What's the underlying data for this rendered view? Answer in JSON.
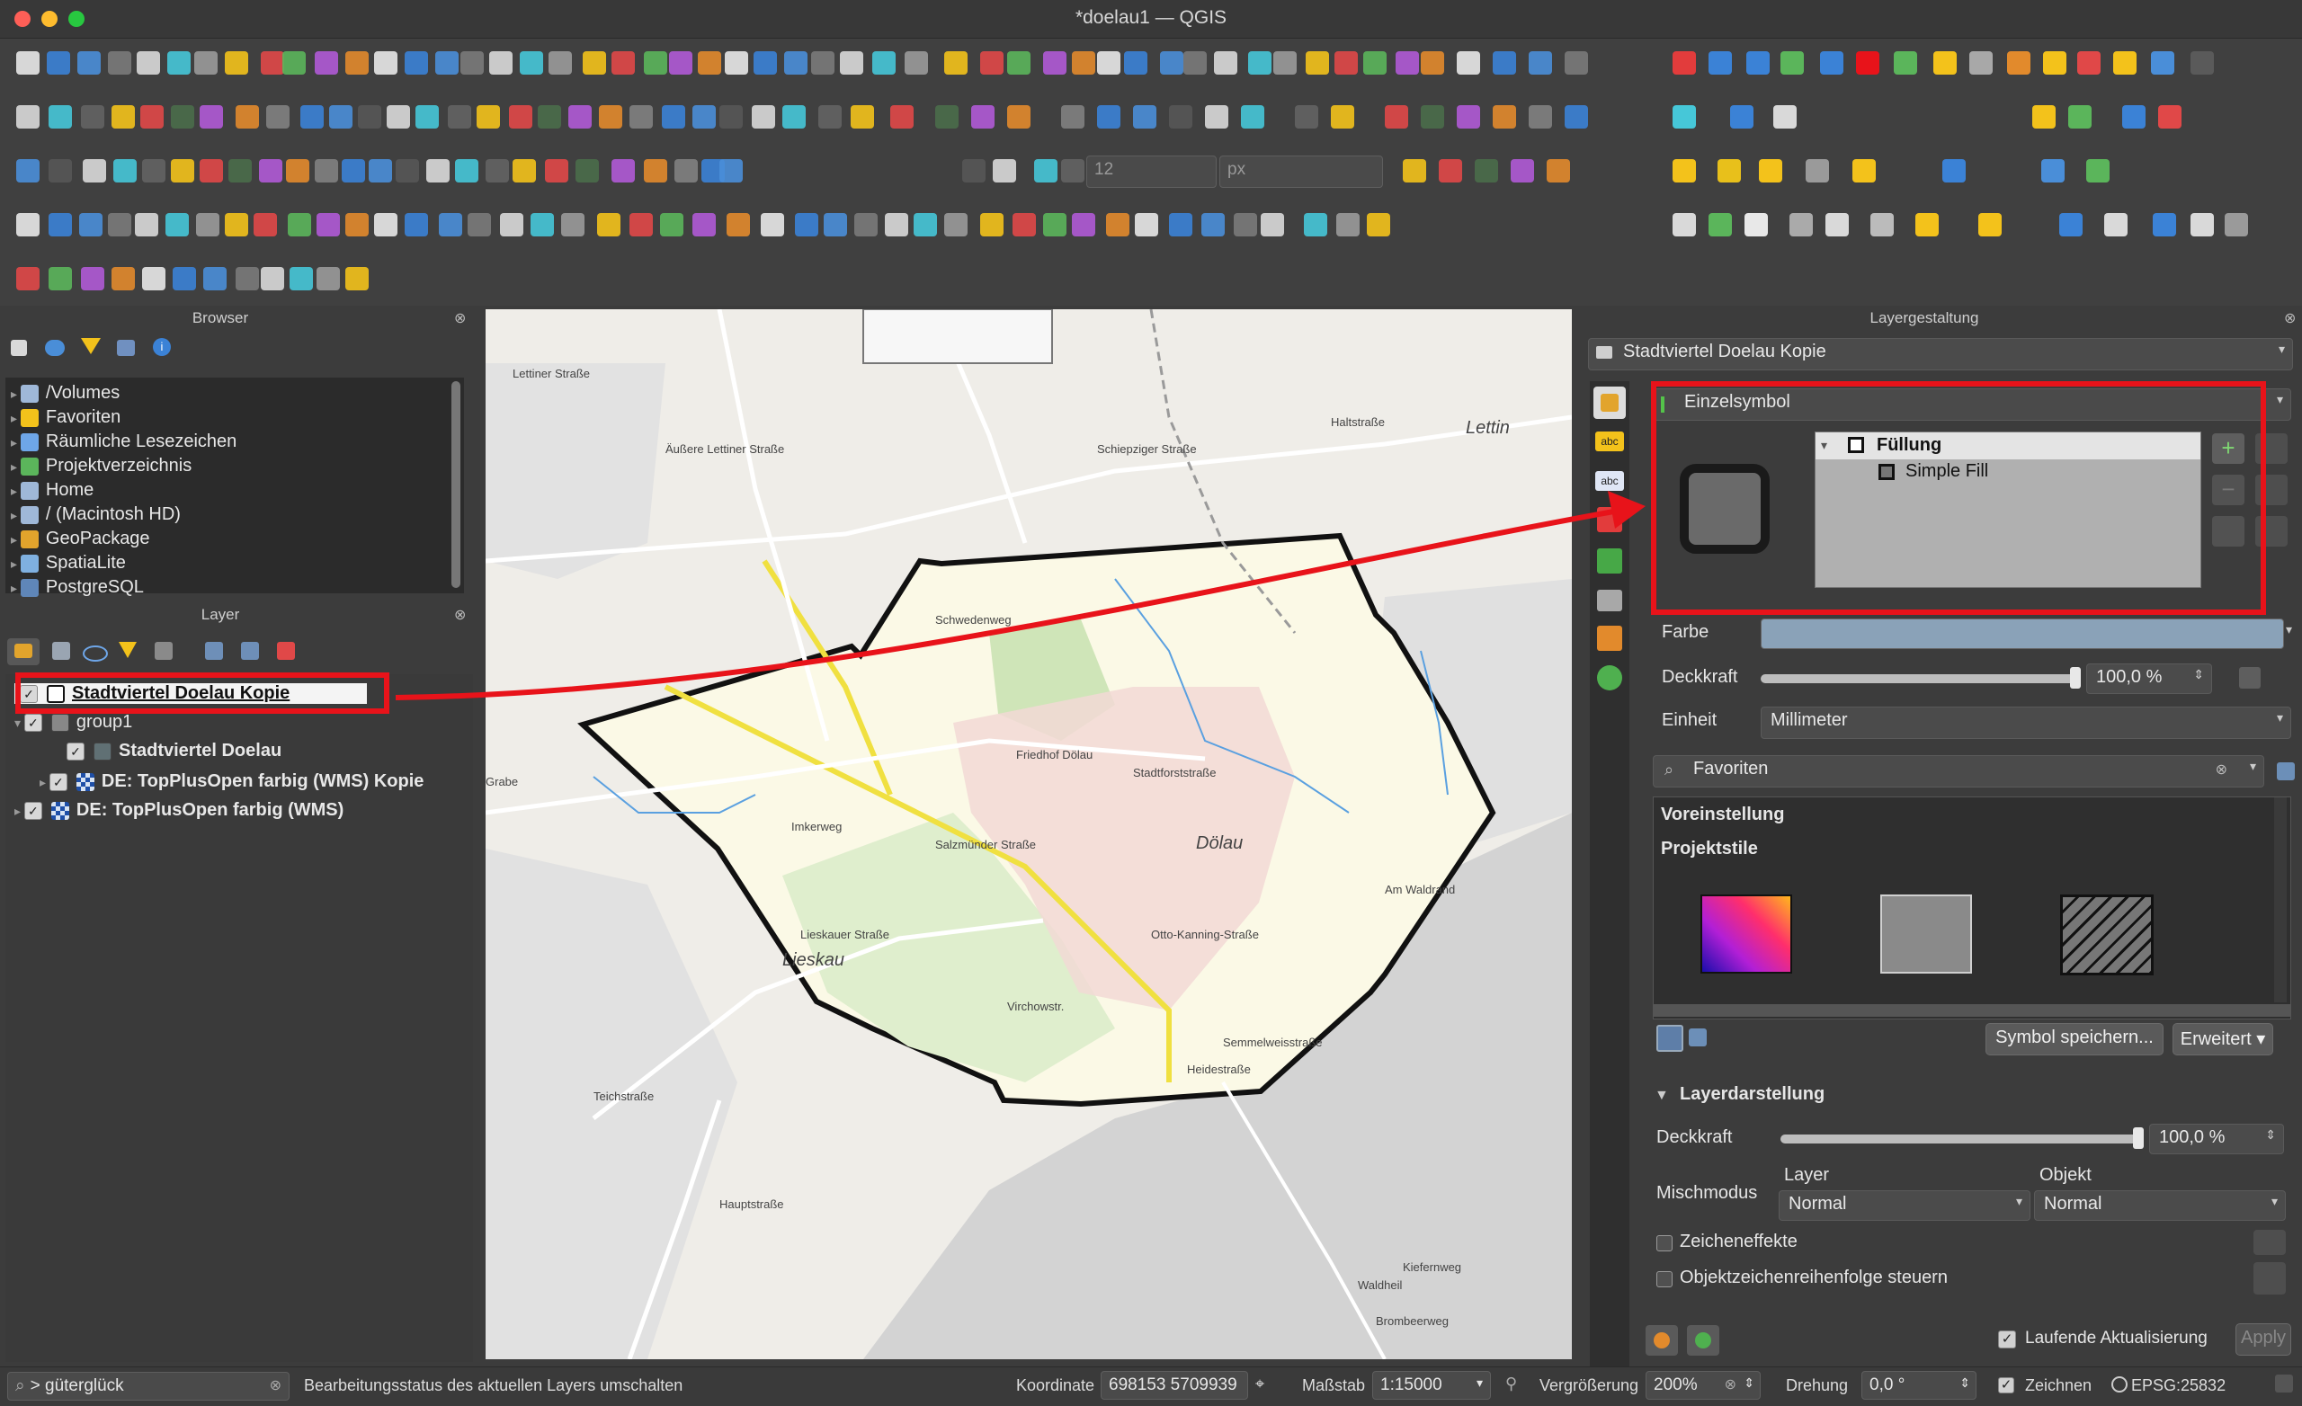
{
  "window": {
    "title": "*doelau1 — QGIS"
  },
  "toolbar": {
    "scale_value": "12",
    "unit_value": "px"
  },
  "browser": {
    "title": "Browser",
    "items": [
      {
        "label": "/Volumes",
        "icon": "folder-icon"
      },
      {
        "label": "Favoriten",
        "icon": "star-icon"
      },
      {
        "label": "Räumliche Lesezeichen",
        "icon": "bookmark-icon"
      },
      {
        "label": "Projektverzeichnis",
        "icon": "project-folder-icon"
      },
      {
        "label": "Home",
        "icon": "folder-icon"
      },
      {
        "label": "/ (Macintosh HD)",
        "icon": "folder-icon"
      },
      {
        "label": "GeoPackage",
        "icon": "geopackage-icon"
      },
      {
        "label": "SpatiaLite",
        "icon": "spatialite-icon"
      },
      {
        "label": "PostgreSQL",
        "icon": "postgresql-icon"
      }
    ]
  },
  "layers": {
    "title": "Layer",
    "items": [
      {
        "label": "Stadtviertel Doelau Kopie",
        "checked": true
      },
      {
        "label": "group1",
        "checked": true
      },
      {
        "label": "Stadtviertel Doelau",
        "checked": true
      },
      {
        "label": "DE: TopPlusOpen farbig (WMS) Kopie",
        "checked": true
      },
      {
        "label": "DE: TopPlusOpen farbig (WMS)",
        "checked": true
      }
    ]
  },
  "map": {
    "labels": [
      "Lettin",
      "Dölau",
      "Lieskau",
      "Schwedenweg",
      "Lettiner Straße",
      "Äußere Lettiner Straße",
      "Schiepziger Straße",
      "Salzmünder Straße",
      "Friedhof Dölau",
      "Stadtforststraße",
      "Grabe",
      "Haltstraße",
      "Imkerweg",
      "Lieskauer Straße",
      "Semmelweisstraße",
      "Heidestraße",
      "Kiefernweg",
      "Waldheil",
      "Brombeerweg",
      "Virchowstr.",
      "Otto-Kanning-Straße",
      "Am Waldrand",
      "Teichstraße",
      "Hauptstraße"
    ]
  },
  "style_panel": {
    "title": "Layergestaltung",
    "layer_combo": "Stadtviertel Doelau Kopie",
    "renderer": "Einzelsymbol",
    "symbol_tree": {
      "root": "Füllung",
      "child": "Simple Fill"
    },
    "farbe_label": "Farbe",
    "deckkraft_label": "Deckkraft",
    "deckkraft_value": "100,0 %",
    "einheit_label": "Einheit",
    "einheit_value": "Millimeter",
    "search_placeholder": "Favoriten",
    "styles": {
      "heading1": "Voreinstellung",
      "heading2": "Projektstile"
    },
    "save_button": "Symbol speichern...",
    "advanced_button": "Erweitert",
    "layer_render": {
      "heading": "Layerdarstellung",
      "deckkraft_label": "Deckkraft",
      "deckkraft_value": "100,0 %",
      "mischmodus_label": "Mischmodus",
      "layer_col": "Layer",
      "objekt_col": "Objekt",
      "layer_mode": "Normal",
      "objekt_mode": "Normal",
      "effekte_label": "Zeicheneffekte",
      "reihenfolge_label": "Objektzeichenreihenfolge steuern"
    },
    "live_update_label": "Laufende Aktualisierung",
    "apply_button": "Apply"
  },
  "status": {
    "search_value": "> güterglück",
    "message": "Bearbeitungsstatus des aktuellen Layers umschalten",
    "koordinate_label": "Koordinate",
    "koordinate_value": "698153  5709939",
    "massstab_label": "Maßstab",
    "massstab_value": "1:15000",
    "vergroesserung_label": "Vergrößerung",
    "vergroesserung_value": "200%",
    "drehung_label": "Drehung",
    "drehung_value": "0,0 °",
    "zeichnen_label": "Zeichnen",
    "crs": "EPSG:25832"
  },
  "colors": {
    "accent_red": "#e8131a",
    "panel_bg": "#3c3c3c",
    "polygon_fill": "#fbf9e6"
  }
}
